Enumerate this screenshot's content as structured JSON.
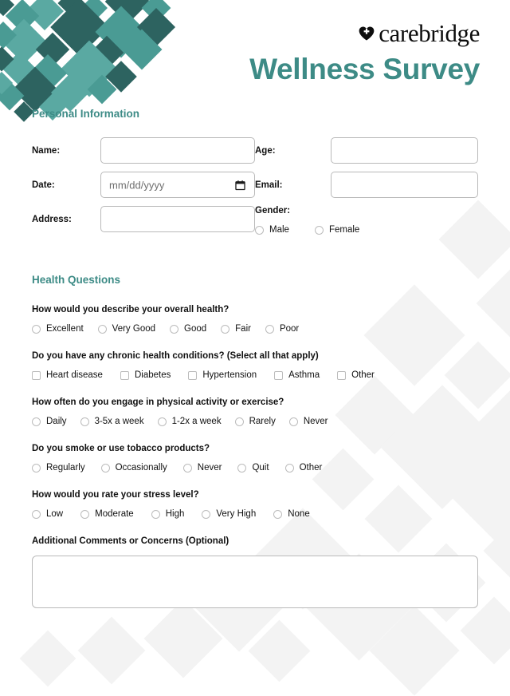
{
  "header": {
    "brand_name": "carebridge",
    "brand_mark_icon": "heart-plus-icon",
    "survey_title": "Wellness Survey"
  },
  "personal_information": {
    "section_title": "Personal Information",
    "name": {
      "label": "Name:",
      "value": "",
      "placeholder": ""
    },
    "date": {
      "label": "Date:",
      "value": "",
      "placeholder": "mm/dd/yyyy",
      "icon": "calendar-icon"
    },
    "address": {
      "label": "Address:",
      "value": "",
      "placeholder": ""
    },
    "age": {
      "label": "Age:",
      "value": "",
      "placeholder": ""
    },
    "email": {
      "label": "Email:",
      "value": "",
      "placeholder": ""
    },
    "gender": {
      "label": "Gender:",
      "options": [
        {
          "label": "Male",
          "selected": false
        },
        {
          "label": "Female",
          "selected": false
        }
      ]
    }
  },
  "health_questions": {
    "section_title": "Health Questions",
    "questions": [
      {
        "id": "overall-health",
        "text": "How would you describe your overall health?",
        "input_type": "radio",
        "options": [
          {
            "label": "Excellent",
            "selected": false
          },
          {
            "label": "Very Good",
            "selected": false
          },
          {
            "label": "Good",
            "selected": false
          },
          {
            "label": "Fair",
            "selected": false
          },
          {
            "label": "Poor",
            "selected": false
          }
        ]
      },
      {
        "id": "chronic-conditions",
        "text": "Do you have any chronic health conditions? (Select all that apply)",
        "input_type": "checkbox",
        "options": [
          {
            "label": "Heart disease",
            "selected": false
          },
          {
            "label": "Diabetes",
            "selected": false
          },
          {
            "label": "Hypertension",
            "selected": false
          },
          {
            "label": "Asthma",
            "selected": false
          },
          {
            "label": "Other",
            "selected": false
          }
        ]
      },
      {
        "id": "physical-activity",
        "text": "How often do you engage in physical activity or exercise?",
        "input_type": "radio",
        "options": [
          {
            "label": "Daily",
            "selected": false
          },
          {
            "label": "3-5x a week",
            "selected": false
          },
          {
            "label": "1-2x a week",
            "selected": false
          },
          {
            "label": "Rarely",
            "selected": false
          },
          {
            "label": "Never",
            "selected": false
          }
        ]
      },
      {
        "id": "tobacco-use",
        "text": "Do you smoke or use tobacco products?",
        "input_type": "radio",
        "options": [
          {
            "label": "Regularly",
            "selected": false
          },
          {
            "label": "Occasionally",
            "selected": false
          },
          {
            "label": "Never",
            "selected": false
          },
          {
            "label": "Quit",
            "selected": false
          },
          {
            "label": "Other",
            "selected": false
          }
        ]
      },
      {
        "id": "stress-level",
        "text": "How would you rate your stress level?",
        "input_type": "radio",
        "options": [
          {
            "label": "Low",
            "selected": false
          },
          {
            "label": "Moderate",
            "selected": false
          },
          {
            "label": "High",
            "selected": false
          },
          {
            "label": "Very High",
            "selected": false
          },
          {
            "label": "None",
            "selected": false
          }
        ]
      }
    ]
  },
  "comments": {
    "label": "Additional Comments or Concerns (Optional)",
    "value": "",
    "placeholder": ""
  },
  "colors": {
    "teal_accent": "#3d8b86",
    "teal_dark": "#2d6360",
    "teal_medium": "#4a9b94",
    "teal_light": "#5aa9a2",
    "watermark_grey": "#f3f3f3",
    "input_border": "#b9b9b9",
    "text_dark": "#111111"
  }
}
